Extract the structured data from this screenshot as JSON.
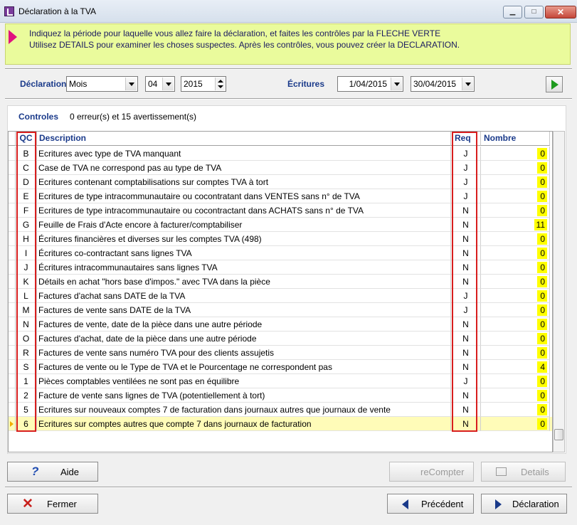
{
  "window": {
    "title": "Déclaration à la TVA",
    "minimize": "▁",
    "maximize": "□",
    "close": "✕"
  },
  "info": {
    "line1": "Indiquez la période pour laquelle vous allez faire la déclaration, et faites les contrôles par la FLECHE VERTE",
    "line2": "Utilisez DETAILS pour examiner les choses suspectes.  Après les contrôles, vous pouvez créer la DECLARATION."
  },
  "form": {
    "declaration_label": "Déclaration",
    "period_type": "Mois",
    "month": "04",
    "year": "2015",
    "ecritures_label": "Écritures",
    "date_from": "1/04/2015",
    "date_to": "30/04/2015"
  },
  "controls": {
    "label": "Controles",
    "summary": "0 erreur(s) et 15 avertissement(s)"
  },
  "table": {
    "headers": {
      "qc": "QC",
      "description": "Description",
      "req": "Req",
      "nombre": "Nombre"
    },
    "rows": [
      {
        "qc": "B",
        "description": "Ecritures avec type de TVA manquant",
        "req": "J",
        "nombre": "0"
      },
      {
        "qc": "C",
        "description": "Case de TVA ne correspond pas au type de TVA",
        "req": "J",
        "nombre": "0"
      },
      {
        "qc": "D",
        "description": "Ecritures contenant comptabilisations sur comptes TVA à tort",
        "req": "J",
        "nombre": "0"
      },
      {
        "qc": "E",
        "description": "Ecritures de type intracommunautaire ou cocontratant dans VENTES sans n° de TVA",
        "req": "J",
        "nombre": "0"
      },
      {
        "qc": "F",
        "description": "Ecritures de type intracommunautaire ou cocontractant dans ACHATS sans n° de TVA",
        "req": "N",
        "nombre": "0"
      },
      {
        "qc": "G",
        "description": "Feuille de Frais d'Acte encore à facturer/comptabiliser",
        "req": "N",
        "nombre": "11"
      },
      {
        "qc": "H",
        "description": "Écritures financières et diverses sur les comptes TVA (498)",
        "req": "N",
        "nombre": "0"
      },
      {
        "qc": "I",
        "description": "Écritures co-contractant sans lignes TVA",
        "req": "N",
        "nombre": "0"
      },
      {
        "qc": "J",
        "description": "Écritures intracommunautaires sans lignes TVA",
        "req": "N",
        "nombre": "0"
      },
      {
        "qc": "K",
        "description": "Détails en achat \"hors base d'impos.\" avec TVA dans la pièce",
        "req": "N",
        "nombre": "0"
      },
      {
        "qc": "L",
        "description": "Factures d'achat sans DATE de la TVA",
        "req": "J",
        "nombre": "0"
      },
      {
        "qc": "M",
        "description": "Factures de vente sans DATE de la TVA",
        "req": "J",
        "nombre": "0"
      },
      {
        "qc": "N",
        "description": "Factures de vente, date de la pièce dans une autre période",
        "req": "N",
        "nombre": "0"
      },
      {
        "qc": "O",
        "description": "Factures d'achat, date de la pièce dans une autre période",
        "req": "N",
        "nombre": "0"
      },
      {
        "qc": "R",
        "description": "Factures de vente sans numéro TVA pour des clients assujetis",
        "req": "N",
        "nombre": "0"
      },
      {
        "qc": "S",
        "description": "Factures de vente ou le Type de TVA et le Pourcentage ne correspondent pas",
        "req": "N",
        "nombre": "4"
      },
      {
        "qc": "1",
        "description": "Pièces comptables ventilées ne sont pas en équilibre",
        "req": "J",
        "nombre": "0"
      },
      {
        "qc": "2",
        "description": "Facture de vente sans lignes de TVA (potentiellement à tort)",
        "req": "N",
        "nombre": "0"
      },
      {
        "qc": "5",
        "description": "Ecritures sur nouveaux comptes 7 de facturation dans journaux autres que journaux de vente",
        "req": "N",
        "nombre": "0"
      },
      {
        "qc": "6",
        "description": "Ecritures sur comptes autres que compte 7 dans journaux de facturation",
        "req": "N",
        "nombre": "0"
      }
    ]
  },
  "buttons": {
    "aide": "Aide",
    "recompter": "reCompter",
    "details": "Details",
    "fermer": "Fermer",
    "precedent": "Précédent",
    "declaration": "Déclaration"
  }
}
